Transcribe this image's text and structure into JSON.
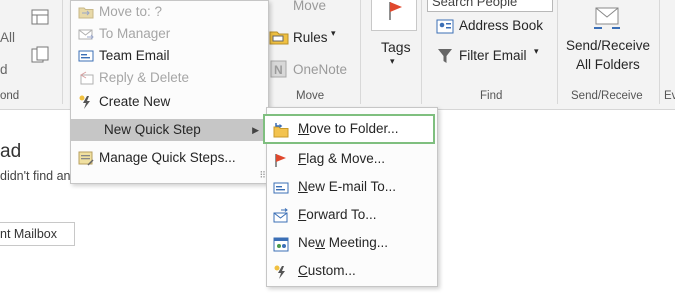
{
  "ribbon": {
    "left_labels": [
      "All",
      "d",
      "ond"
    ],
    "move_group": {
      "move": "Move",
      "rules": "Rules",
      "onenote": "OneNote",
      "label": "Move"
    },
    "tags_group": {
      "label": "Tags"
    },
    "find_group": {
      "search_people": "Search People",
      "address_book": "Address Book",
      "filter_email": "Filter Email",
      "label": "Find"
    },
    "send_receive_group": {
      "button": "Send/Receive All Folders",
      "line1": "Send/Receive",
      "line2": "All Folders",
      "label": "Send/Receive"
    },
    "right_cut": "Ev",
    "accent_flag_color": "#e0482d"
  },
  "background": {
    "mailbox": "nt Mailbox",
    "heading": "ad",
    "body": "didn't find any"
  },
  "quick_steps_menu": {
    "items": [
      {
        "label": "Move to: ?",
        "icon": "folder-arrow-icon",
        "enabled": false
      },
      {
        "label": "To Manager",
        "icon": "forward-envelope-icon",
        "enabled": false
      },
      {
        "label": "Team Email",
        "icon": "envelope-icon",
        "enabled": true
      },
      {
        "label": "Reply & Delete",
        "icon": "reply-envelope-icon",
        "enabled": false
      },
      {
        "label": "Create New",
        "icon": "lightning-icon",
        "enabled": true
      },
      {
        "label": "New Quick Step",
        "icon": "",
        "enabled": true,
        "has_submenu": true,
        "highlighted": true
      },
      {
        "label": "Manage Quick Steps...",
        "icon": "manage-quick-steps-icon",
        "enabled": true
      }
    ]
  },
  "new_quick_step_submenu": {
    "items": [
      {
        "label": "Move to Folder...",
        "icon": "folder-move-icon",
        "selected": true
      },
      {
        "label": "Flag & Move...",
        "icon": "flag-icon"
      },
      {
        "label": "New E-mail To...",
        "icon": "new-email-icon"
      },
      {
        "label": "Forward To...",
        "icon": "forward-icon"
      },
      {
        "label": "New Meeting...",
        "icon": "meeting-icon"
      },
      {
        "label": "Custom...",
        "icon": "custom-lightning-icon"
      }
    ]
  }
}
